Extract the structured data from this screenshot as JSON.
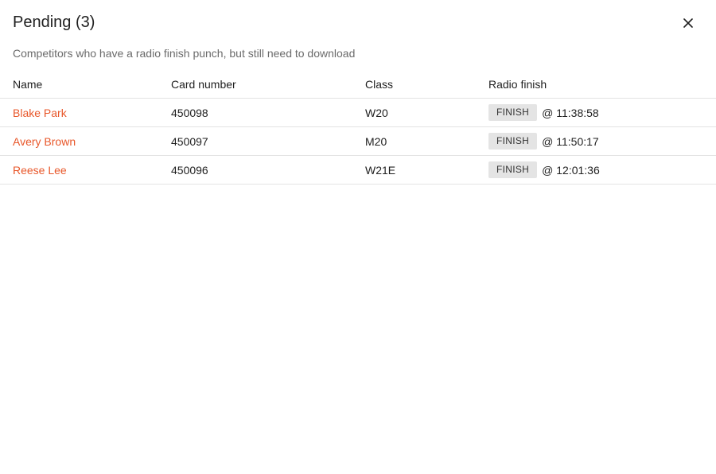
{
  "dialog": {
    "title": "Pending (3)",
    "subtitle": "Competitors who have a radio finish punch, but still need to download",
    "close_icon": "close-icon"
  },
  "table": {
    "headers": {
      "name": "Name",
      "card_number": "Card number",
      "class": "Class",
      "radio_finish": "Radio finish"
    },
    "rows": [
      {
        "name": "Blake Park",
        "card_number": "450098",
        "class": "W20",
        "badge": "FINISH",
        "time": "@ 11:38:58"
      },
      {
        "name": "Avery Brown",
        "card_number": "450097",
        "class": "M20",
        "badge": "FINISH",
        "time": "@ 11:50:17"
      },
      {
        "name": "Reese Lee",
        "card_number": "450096",
        "class": "W21E",
        "badge": "FINISH",
        "time": "@ 12:01:36"
      }
    ]
  },
  "colors": {
    "accent": "#e8572a",
    "badge_bg": "#e4e4e4",
    "divider": "#e3e3e3",
    "subtitle": "#6b6b6b"
  }
}
